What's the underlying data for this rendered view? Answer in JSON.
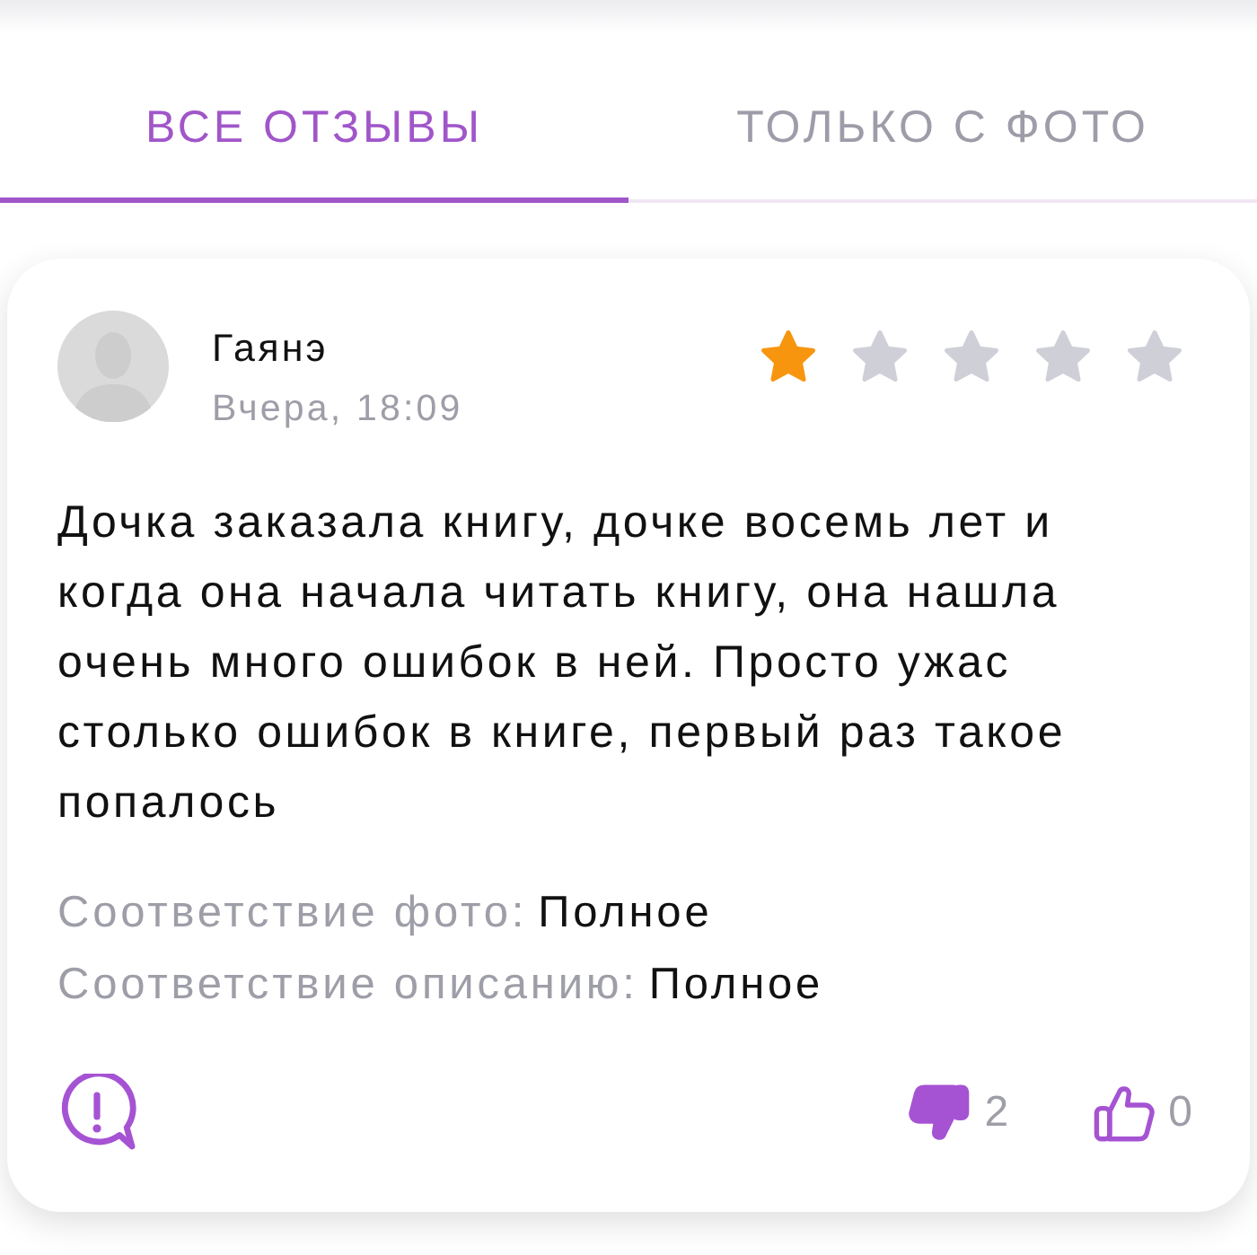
{
  "tabs": [
    {
      "label": "ВСЕ ОТЗЫВЫ",
      "selected": true
    },
    {
      "label": "ТОЛЬКО С ФОТО",
      "selected": false
    }
  ],
  "review": {
    "author": "Гаянэ",
    "date": "Вчера, 18:09",
    "stars": 1,
    "text": "Дочка заказала книгу, дочке восемь лет и когда она начала читать книгу, она нашла очень много ошибок в ней. Просто ужас столько ошибок в книге, первый раз такое попалось",
    "attributes": [
      {
        "label": "Соответствие фото:",
        "value": "Полное"
      },
      {
        "label": "Соответствие описанию:",
        "value": "Полное"
      }
    ],
    "votes": [
      {
        "kind": "dislike",
        "count": "2",
        "active": true
      },
      {
        "kind": "like",
        "count": "0",
        "active": false
      }
    ]
  }
}
